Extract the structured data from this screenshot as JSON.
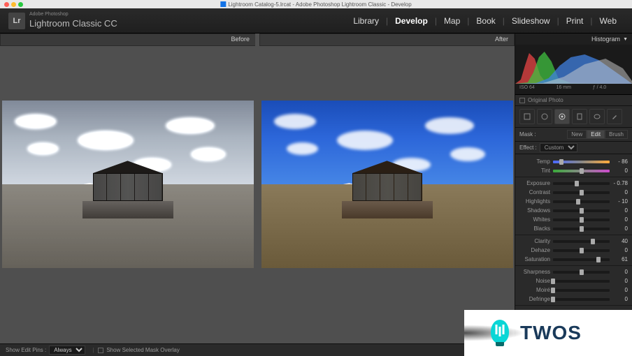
{
  "titlebar": {
    "title": "Lightroom Catalog-5.lrcat - Adobe Photoshop Lightroom Classic - Develop"
  },
  "header": {
    "brand_small": "Adobe Photoshop",
    "brand_big": "Lightroom Classic CC",
    "logo_letters": "Lr",
    "modules": [
      "Library",
      "Develop",
      "Map",
      "Book",
      "Slideshow",
      "Print",
      "Web"
    ],
    "active_module": "Develop"
  },
  "canvas": {
    "before_label": "Before",
    "after_label": "After"
  },
  "panel": {
    "histogram_title": "Histogram",
    "iso": "ISO 64",
    "focal": "16 mm",
    "aperture": "ƒ / 4.0",
    "flash": "",
    "original_photo": "Original Photo",
    "mask_label": "Mask :",
    "mask_tabs": [
      "New",
      "Edit",
      "Brush"
    ],
    "mask_active": "Edit",
    "effect_label": "Effect :",
    "effect_value": "Custom",
    "sliders": {
      "group1": [
        {
          "label": "Temp",
          "value": "- 86",
          "pos": 15,
          "track": "temp"
        },
        {
          "label": "Tint",
          "value": "0",
          "pos": 50,
          "track": "tint"
        }
      ],
      "group2": [
        {
          "label": "Exposure",
          "value": "- 0.78",
          "pos": 42
        },
        {
          "label": "Contrast",
          "value": "0",
          "pos": 50
        },
        {
          "label": "Highlights",
          "value": "- 10",
          "pos": 45
        },
        {
          "label": "Shadows",
          "value": "0",
          "pos": 50
        },
        {
          "label": "Whites",
          "value": "0",
          "pos": 50
        },
        {
          "label": "Blacks",
          "value": "0",
          "pos": 50
        }
      ],
      "group3": [
        {
          "label": "Clarity",
          "value": "40",
          "pos": 70
        },
        {
          "label": "Dehaze",
          "value": "0",
          "pos": 50
        },
        {
          "label": "Saturation",
          "value": "61",
          "pos": 80
        }
      ],
      "group4": [
        {
          "label": "Sharpness",
          "value": "0",
          "pos": 50
        },
        {
          "label": "Noise",
          "value": "0",
          "pos": 0
        },
        {
          "label": "Moiré",
          "value": "0",
          "pos": 0
        },
        {
          "label": "Defringe",
          "value": "0",
          "pos": 0
        }
      ]
    }
  },
  "bottombar": {
    "show_edit_pins": "Show Edit Pins :",
    "pins_value": "Always",
    "overlay_label": "Show Selected Mask Overlay"
  },
  "watermark": {
    "text": "TWOS"
  }
}
